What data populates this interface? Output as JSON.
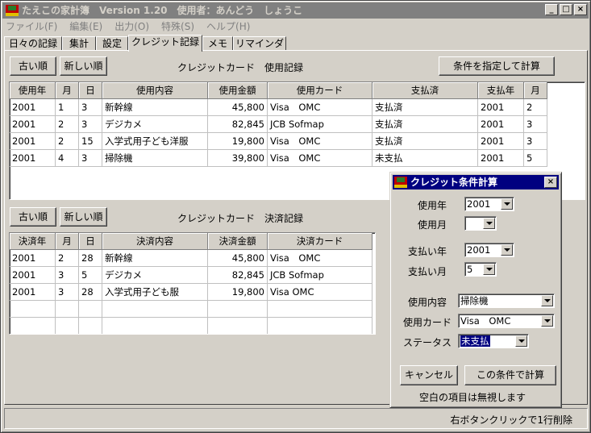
{
  "window": {
    "title": "たえこの家計簿　Version 1.20　使用者：あんどう　しょうこ",
    "buttons": [
      "_",
      "□",
      "×"
    ]
  },
  "menu": [
    "ファイル(F)",
    "編集(E)",
    "出力(O)",
    "特殊(S)",
    "ヘルプ(H)"
  ],
  "tabs": [
    "日々の記録",
    "集計",
    "設定",
    "クレジット記録",
    "メモ",
    "リマインダ"
  ],
  "active_tab": "クレジット記録",
  "usage": {
    "old_button": "古い順",
    "new_button": "新しい順",
    "title": "クレジットカード　使用記録",
    "calc_button": "条件を指定して計算",
    "columns": [
      "使用年",
      "月",
      "日",
      "使用内容",
      "使用金額",
      "使用カード",
      "支払済",
      "支払年",
      "月"
    ],
    "rows": [
      [
        "2001",
        "1",
        "3",
        "新幹線",
        "45,800",
        "Visa　OMC",
        "支払済",
        "2001",
        "2"
      ],
      [
        "2001",
        "2",
        "3",
        "デジカメ",
        "82,845",
        "JCB Sofmap",
        "支払済",
        "2001",
        "3"
      ],
      [
        "2001",
        "2",
        "15",
        "入学式用子ども洋服",
        "19,800",
        "Visa　OMC",
        "支払済",
        "2001",
        "3"
      ],
      [
        "2001",
        "4",
        "3",
        "掃除機",
        "39,800",
        "Visa　OMC",
        "未支払",
        "2001",
        "5"
      ]
    ]
  },
  "settle": {
    "old_button": "古い順",
    "new_button": "新しい順",
    "title": "クレジットカード　決済記録",
    "columns": [
      "決済年",
      "月",
      "日",
      "決済内容",
      "決済金額",
      "決済カード"
    ],
    "rows": [
      [
        "2001",
        "2",
        "28",
        "新幹線",
        "45,800",
        "Visa　OMC"
      ],
      [
        "2001",
        "3",
        "5",
        "デジカメ",
        "82,845",
        "JCB Sofmap"
      ],
      [
        "2001",
        "3",
        "28",
        "入学式用子ども服",
        "19,800",
        "Visa OMC"
      ],
      [
        "",
        "",
        "",
        "",
        "",
        ""
      ],
      [
        "",
        "",
        "",
        "",
        "",
        ""
      ]
    ]
  },
  "status_text": "右ボタンクリックで1行削除",
  "dialog": {
    "title": "クレジット条件計算",
    "close": "×",
    "fields": [
      {
        "label": "使用年",
        "value": "2001"
      },
      {
        "label": "使用月",
        "value": ""
      },
      {
        "label": "支払い年",
        "value": "2001"
      },
      {
        "label": "支払い月",
        "value": "5"
      },
      {
        "label": "使用内容",
        "value": "掃除機"
      },
      {
        "label": "使用カード",
        "value": "Visa　OMC"
      },
      {
        "label": "ステータス",
        "value": "未支払"
      }
    ],
    "cancel_button": "キャンセル",
    "ok_button": "この条件で計算",
    "note": "空白の項目は無視します"
  },
  "colors": {
    "title_inactive": "#808080",
    "dialog_title": "#000080",
    "face": "#d4d0c8"
  },
  "icons": [
    "app-icon",
    "minimize-icon",
    "maximize-icon",
    "close-icon",
    "dropdown-arrow-icon"
  ]
}
